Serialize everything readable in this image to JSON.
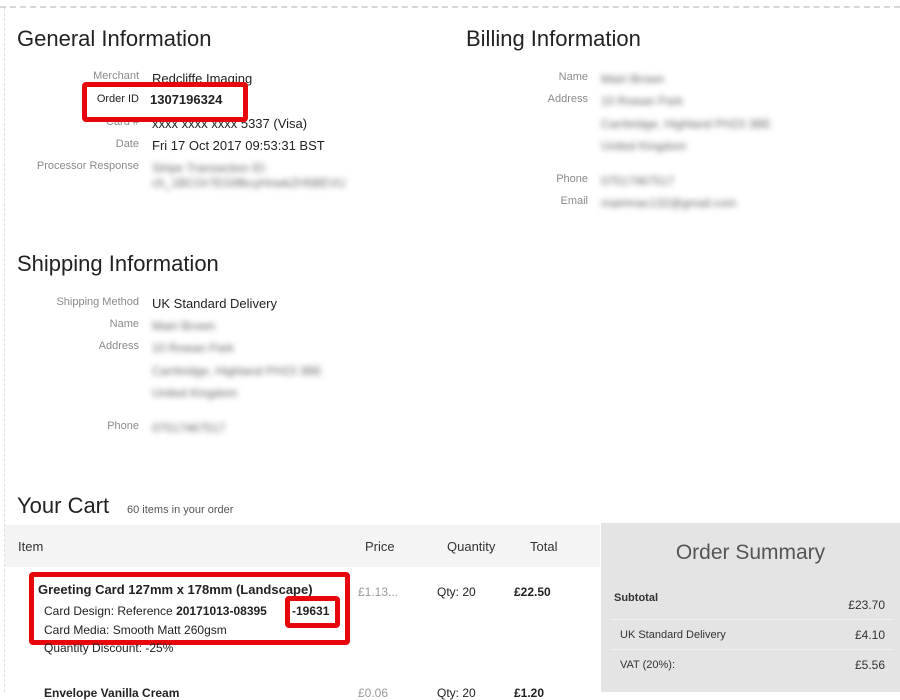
{
  "general": {
    "title": "General Information",
    "merchant_label": "Merchant",
    "merchant_value": "Redcliffe Imaging",
    "order_id_label": "Order ID",
    "order_id_value": "1307196324",
    "card_label": "Card #",
    "card_value": "xxxx xxxx xxxx 5337 (Visa)",
    "date_label": "Date",
    "date_value": "Fri 17 Oct 2017 09:53:31 BST",
    "processor_label": "Processor Response",
    "processor_value_1": "Stripe Transaction ID:",
    "processor_value_2": "ch_1BCOr7EG9fkcyHnwkZH5BEVU"
  },
  "billing": {
    "title": "Billing Information",
    "name_label": "Name",
    "name_value": "Mairi Brown",
    "address_label": "Address",
    "address_lines": [
      "10 Rowan Park",
      "Carrbridge, Highland PH23 3BE",
      "United Kingdom"
    ],
    "phone_label": "Phone",
    "phone_value": "07517467517",
    "email_label": "Email",
    "email_value": "mairimac132@gmail.com"
  },
  "shipping": {
    "title": "Shipping Information",
    "method_label": "Shipping Method",
    "method_value": "UK Standard Delivery",
    "name_label": "Name",
    "name_value": "Mairi Brown",
    "address_label": "Address",
    "address_lines": [
      "10 Rowan Park",
      "Carrbridge, Highland PH23 3BE",
      "United Kingdom"
    ],
    "phone_label": "Phone",
    "phone_value": "07517467517"
  },
  "cart": {
    "title": "Your Cart",
    "count_text": "60 items in your order",
    "col_item": "Item",
    "col_price": "Price",
    "col_quantity": "Quantity",
    "col_total": "Total",
    "items": [
      {
        "name": "Greeting Card 127mm x 178mm (Landscape)",
        "design_prefix": "Card Design: Reference",
        "design_ref": "20171013-08395",
        "design_suffix": "-19631",
        "media": "Card Media: Smooth Matt 260gsm",
        "discount": "Quantity Discount: -25%",
        "price": "£1.13...",
        "qty": "Qty: 20",
        "total": "£22.50"
      },
      {
        "name": "Envelope Vanilla Cream",
        "price": "£0.06",
        "qty": "Qty: 20",
        "total": "£1.20"
      }
    ]
  },
  "summary": {
    "title": "Order Summary",
    "subtotal_label": "Subtotal",
    "subtotal_value": "£23.70",
    "delivery_label": "UK Standard Delivery",
    "delivery_value": "£4.10",
    "vat_label": "VAT (20%):",
    "vat_value": "£5.56"
  }
}
